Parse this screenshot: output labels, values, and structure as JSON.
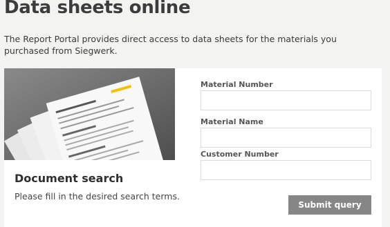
{
  "page": {
    "title": "Data sheets online",
    "intro": "The Report Portal provides direct access to data sheets for the materials you purchased from Siegwerk."
  },
  "search_panel": {
    "heading": "Document search",
    "subtitle": "Please fill in the desired search terms."
  },
  "form": {
    "fields": [
      {
        "label": "Material Number",
        "value": ""
      },
      {
        "label": "Material Name",
        "value": ""
      },
      {
        "label": "Customer Number",
        "value": ""
      }
    ],
    "submit_label": "Submit query"
  },
  "image": {
    "icon": "stacked-data-sheets-photo"
  }
}
